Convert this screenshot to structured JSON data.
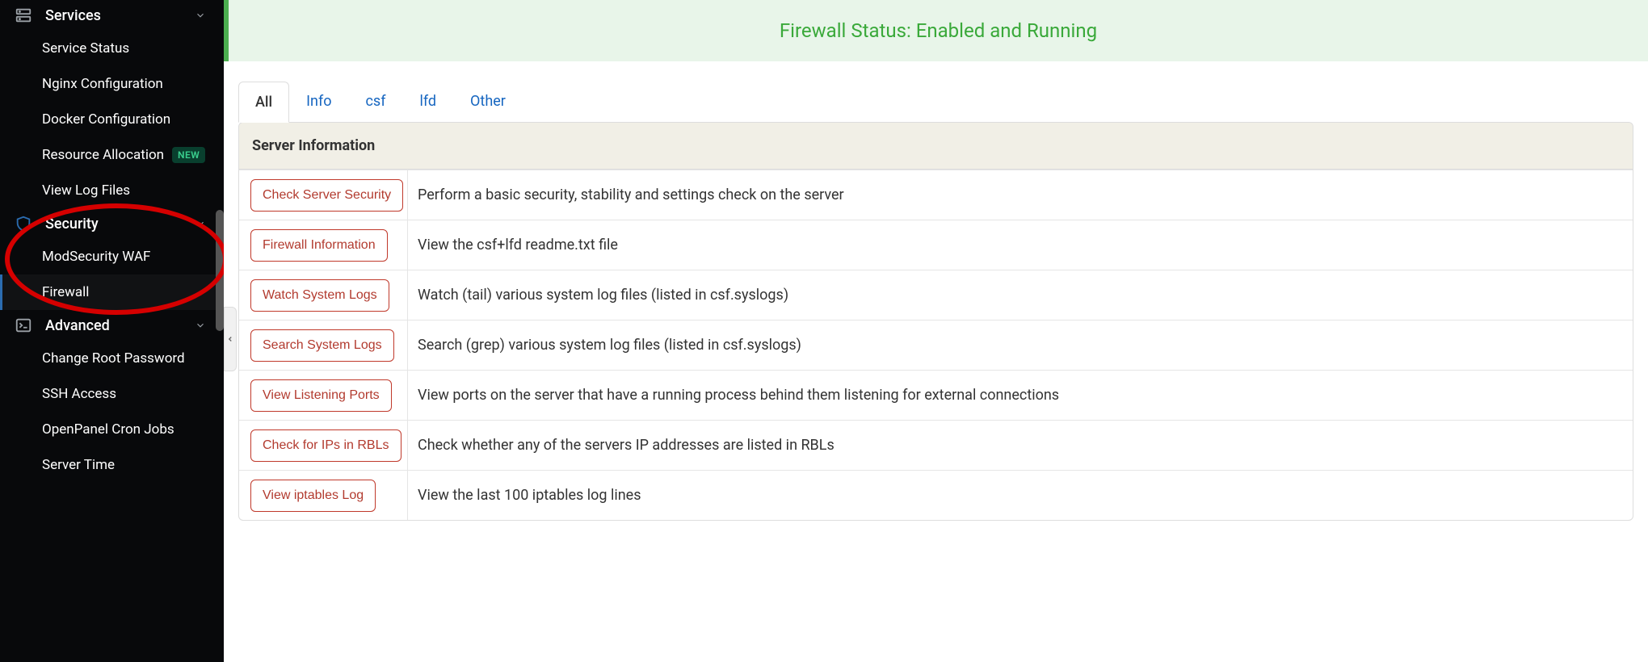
{
  "sidebar": {
    "sections": {
      "services": {
        "label": "Services",
        "items": [
          {
            "label": "Service Status"
          },
          {
            "label": "Nginx Configuration"
          },
          {
            "label": "Docker Configuration"
          },
          {
            "label": "Resource Allocation",
            "badge": "NEW"
          },
          {
            "label": "View Log Files"
          }
        ]
      },
      "security": {
        "label": "Security",
        "items": [
          {
            "label": "ModSecurity WAF"
          },
          {
            "label": "Firewall",
            "active": true
          }
        ]
      },
      "advanced": {
        "label": "Advanced",
        "items": [
          {
            "label": "Change Root Password"
          },
          {
            "label": "SSH Access"
          },
          {
            "label": "OpenPanel Cron Jobs"
          },
          {
            "label": "Server Time"
          }
        ]
      }
    }
  },
  "status_banner": "Firewall Status: Enabled and Running",
  "tabs": [
    "All",
    "Info",
    "csf",
    "lfd",
    "Other"
  ],
  "active_tab": "All",
  "panel_title": "Server Information",
  "rows": [
    {
      "button": "Check Server Security",
      "desc": "Perform a basic security, stability and settings check on the server"
    },
    {
      "button": "Firewall Information",
      "desc": "View the csf+lfd readme.txt file"
    },
    {
      "button": "Watch System Logs",
      "desc": "Watch (tail) various system log files (listed in csf.syslogs)"
    },
    {
      "button": "Search System Logs",
      "desc": "Search (grep) various system log files (listed in csf.syslogs)"
    },
    {
      "button": "View Listening Ports",
      "desc": "View ports on the server that have a running process behind them listening for external connections"
    },
    {
      "button": "Check for IPs in RBLs",
      "desc": "Check whether any of the servers IP addresses are listed in RBLs"
    },
    {
      "button": "View iptables Log",
      "desc": "View the last 100 iptables log lines"
    }
  ]
}
